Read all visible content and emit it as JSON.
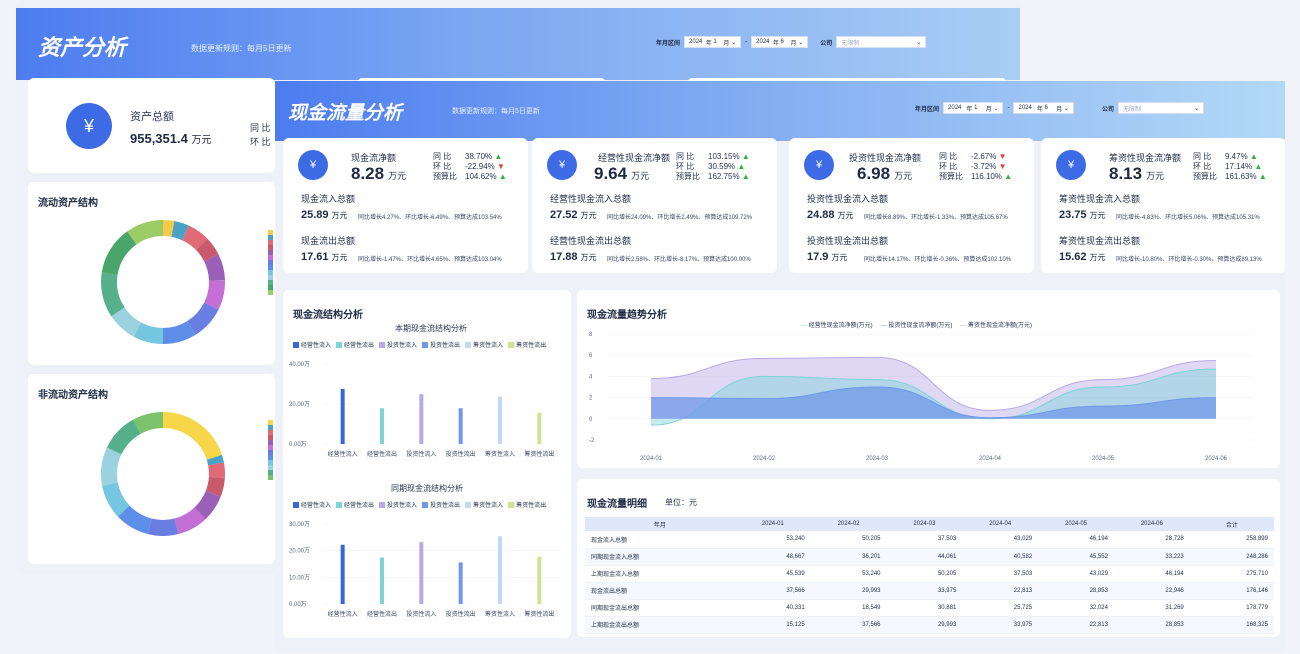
{
  "back": {
    "title": "资产分析",
    "subtitle": "数据更新规则：每月5日更新",
    "filter": {
      "label": "年月区间",
      "y1": "2024",
      "n1": "年",
      "m1": "1",
      "mo1": "月",
      "sep": "-",
      "y2": "2024",
      "n2": "年",
      "m2": "6",
      "mo2": "月",
      "company_label": "公司",
      "company_placeholder": "无限制"
    },
    "total": {
      "name": "资产总额",
      "value": "955,351.4",
      "unit": "万元",
      "yoy_label": "同 比",
      "mom_label": "环 比"
    },
    "current_title": "流动资产结构",
    "noncurrent_title": "非流动资产结构"
  },
  "front": {
    "title": "现金流量分析",
    "subtitle": "数据更新规则：每月5日更新",
    "filter": {
      "label": "年月区间",
      "y1": "2024",
      "n1": "年",
      "m1": "1",
      "mo1": "月",
      "sep": "-",
      "y2": "2024",
      "n2": "年",
      "m2": "6",
      "mo2": "月",
      "company_label": "公司",
      "company_placeholder": "无限制"
    },
    "kpis": [
      {
        "name": "现金流净额",
        "value": "8.28",
        "unit": "万元",
        "yoy": "38.70%",
        "mom": "-22.94%",
        "bud": "104.62%",
        "yoy_dir": "up",
        "mom_dir": "dn",
        "bud_dir": "up",
        "in_label": "现金流入总额",
        "in_val": "25.89",
        "in_unit": "万元",
        "in_desc": "同比增长4.27%、环比增长-6.49%、预算达成103.54%",
        "out_label": "现金流出总额",
        "out_val": "17.61",
        "out_unit": "万元",
        "out_desc": "同比增长-1.47%、环比增长4.65%、预算达成103.04%"
      },
      {
        "name": "经营性现金流净额",
        "value": "9.64",
        "unit": "万元",
        "yoy": "103.15%",
        "mom": "30.59%",
        "bud": "162.75%",
        "yoy_dir": "up",
        "mom_dir": "up",
        "bud_dir": "up",
        "in_label": "经营性现金流入总额",
        "in_val": "27.52",
        "in_unit": "万元",
        "in_desc": "同比增长24.09%、环比增长2.49%、预算达成109.72%",
        "out_label": "经营性现金流出总额",
        "out_val": "17.88",
        "out_unit": "万元",
        "out_desc": "同比增长2.58%、环比增长-8.17%、预算达成100.00%"
      },
      {
        "name": "投资性现金流净额",
        "value": "6.98",
        "unit": "万元",
        "yoy": "-2.67%",
        "mom": "-3.72%",
        "bud": "116.10%",
        "yoy_dir": "dn",
        "mom_dir": "dn",
        "bud_dir": "up",
        "in_label": "投资性现金流入总额",
        "in_val": "24.88",
        "in_unit": "万元",
        "in_desc": "同比增长8.89%、环比增长-1.33%、预算达成105.67%",
        "out_label": "投资性现金流出总额",
        "out_val": "17.9",
        "out_unit": "万元",
        "out_desc": "同比增长14.17%、环比增长-0.36%、预算达成102.10%"
      },
      {
        "name": "筹资性现金流净额",
        "value": "8.13",
        "unit": "万元",
        "yoy": "9.47%",
        "mom": "17.14%",
        "bud": "161.63%",
        "yoy_dir": "up",
        "mom_dir": "up",
        "bud_dir": "up",
        "in_label": "筹资性现金流入总额",
        "in_val": "23.75",
        "in_unit": "万元",
        "in_desc": "同比增长-4.83%、环比增长5.06%、预算达成105.31%",
        "out_label": "筹资性现金流出总额",
        "out_val": "15.62",
        "out_unit": "万元",
        "out_desc": "同比增长-10.80%、环比增长-0.30%、预算达成89.13%"
      }
    ],
    "kpi_labels": {
      "yoy": "同 比",
      "mom": "环 比",
      "bud": "预算比"
    },
    "struct_title": "现金流结构分析",
    "trend_title": "现金流量趋势分析",
    "detail_title": "现金流量明细",
    "detail_unit": "单位：元"
  },
  "chart_data": [
    {
      "type": "bar",
      "title": "本期现金流结构分析",
      "categories": [
        "经营性流入",
        "经营性流出",
        "投资性流入",
        "投资性流出",
        "筹资性流入",
        "筹资性流出"
      ],
      "values": [
        27.52,
        17.88,
        24.88,
        17.9,
        23.75,
        15.62
      ],
      "colors": [
        "#3a66d6",
        "#7dd3d8",
        "#b7a9e6",
        "#6f98e8",
        "#c3d7f6",
        "#cfe38e"
      ],
      "yticks": [
        "40.00万",
        "20.00万",
        "0.00万"
      ],
      "ylim": [
        0,
        40
      ]
    },
    {
      "type": "bar",
      "title": "同期现金流结构分析",
      "categories": [
        "经营性流入",
        "经营性流出",
        "投资性流入",
        "投资性流出",
        "筹资性流入",
        "筹资性流出"
      ],
      "values": [
        22.2,
        17.4,
        23.2,
        15.6,
        25.4,
        17.7
      ],
      "colors": [
        "#3a66d6",
        "#7dd3d8",
        "#b7a9e6",
        "#6f98e8",
        "#c3d7f6",
        "#cfe38e"
      ],
      "yticks": [
        "30.00万",
        "20.00万",
        "10.00万",
        "0.00万"
      ],
      "ylim": [
        0,
        30
      ]
    },
    {
      "type": "area",
      "x": [
        "2024-01",
        "2024-02",
        "2024-03",
        "2024-04",
        "2024-05",
        "2024-06"
      ],
      "series": [
        {
          "name": "经营性现金流净额(万元)",
          "values": [
            -0.6,
            4.0,
            3.7,
            0.0,
            3.0,
            4.7
          ],
          "color": "#7dd3d8"
        },
        {
          "name": "投资性现金流净额(万元)",
          "values": [
            2.0,
            1.9,
            3.0,
            0.1,
            1.2,
            2.0
          ],
          "color": "#6f98e8"
        },
        {
          "name": "筹资性现金流净额(万元)",
          "values": [
            3.8,
            5.7,
            5.8,
            0.8,
            3.7,
            5.5
          ],
          "color": "#b7a9e6"
        }
      ],
      "yticks": [
        8,
        6,
        4,
        2,
        0,
        -2
      ],
      "ylim": [
        -2,
        8
      ]
    },
    {
      "type": "pie",
      "title": "流动资产结构",
      "values": [
        3,
        4,
        6,
        5,
        7,
        8,
        9,
        9,
        8,
        8,
        12,
        13,
        10
      ],
      "colors": [
        "#f7c948",
        "#4aa3c6",
        "#e06a77",
        "#c95a6b",
        "#9a5fb7",
        "#c46fd6",
        "#6a7de0",
        "#5d8fe8",
        "#75c6e0",
        "#9ad3df",
        "#56b08c",
        "#4aa56a",
        "#9ccc65"
      ]
    },
    {
      "type": "pie",
      "title": "非流动资产结构",
      "values": [
        20,
        2,
        4,
        5,
        7,
        8,
        8,
        9,
        9,
        10,
        10,
        8
      ],
      "colors": [
        "#f8d64a",
        "#4aa3c6",
        "#e06a77",
        "#c95a6b",
        "#9a5fb7",
        "#c46fd6",
        "#6a7de0",
        "#5d8fe8",
        "#75c6e0",
        "#9ad3df",
        "#56b08c",
        "#7cc26a"
      ]
    }
  ],
  "table": {
    "headers": [
      "年月",
      "2024-01",
      "2024-02",
      "2024-03",
      "2024-04",
      "2024-05",
      "2024-06",
      "合计"
    ],
    "rows": [
      [
        "现金流入总额",
        "53,240",
        "50,205",
        "37,503",
        "43,029",
        "46,194",
        "28,728",
        "258,899"
      ],
      [
        "同期现金流入总额",
        "48,667",
        "36,201",
        "44,061",
        "40,582",
        "45,552",
        "33,223",
        "248,286"
      ],
      [
        "上期现金流入总额",
        "45,539",
        "53,240",
        "50,205",
        "37,503",
        "43,029",
        "46,194",
        "275,710"
      ],
      [
        "现金流出总额",
        "37,566",
        "29,993",
        "33,975",
        "22,813",
        "28,853",
        "22,946",
        "176,146"
      ],
      [
        "同期现金流出总额",
        "40,331",
        "18,549",
        "30,881",
        "25,725",
        "32,024",
        "31,269",
        "178,779"
      ],
      [
        "上期现金流出总额",
        "15,125",
        "37,566",
        "29,993",
        "33,975",
        "22,813",
        "28,853",
        "168,325"
      ]
    ]
  }
}
